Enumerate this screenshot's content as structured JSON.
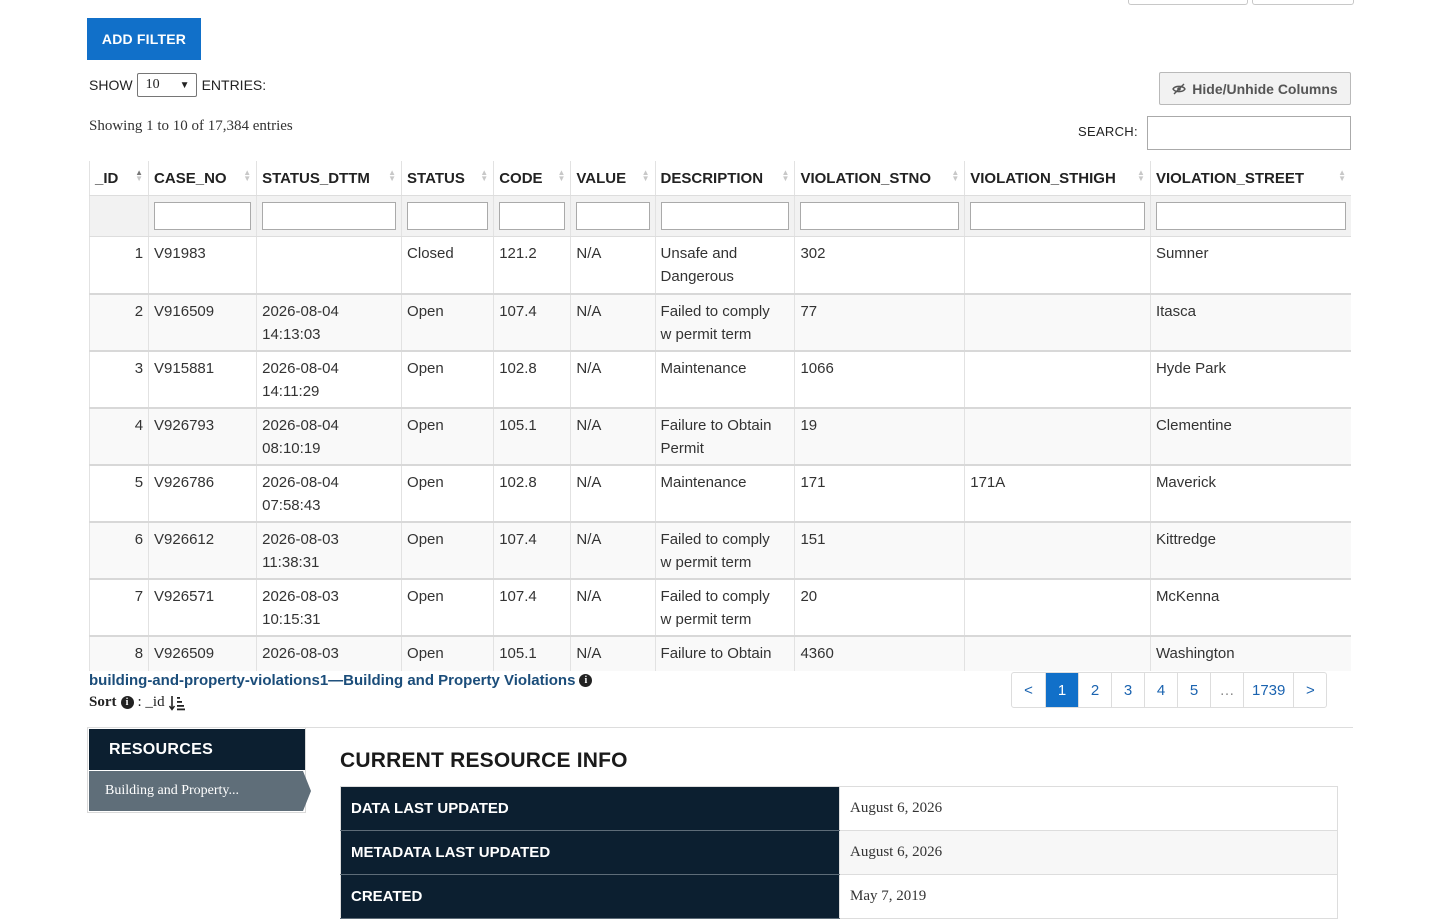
{
  "toolbar": {
    "add_filter_label": "ADD FILTER",
    "show_label": "SHOW",
    "show_value": "10",
    "entries_label": "ENTRIES:",
    "hide_columns_label": "Hide/Unhide Columns",
    "showing_text": "Showing 1 to 10 of 17,384 entries",
    "search_label": "SEARCH:"
  },
  "table": {
    "columns": [
      "_ID",
      "CASE_NO",
      "STATUS_DTTM",
      "STATUS",
      "CODE",
      "VALUE",
      "DESCRIPTION",
      "VIOLATION_STNO",
      "VIOLATION_STHIGH",
      "VIOLATION_STREET"
    ],
    "rows": [
      {
        "id": "1",
        "case_no": "V91983",
        "status_dttm_date": "",
        "status_dttm_time": "",
        "status": "Closed",
        "code": "121.2",
        "value": "N/A",
        "desc1": "Unsafe and",
        "desc2": "Dangerous",
        "stno": "302",
        "sthigh": "",
        "street": "Sumner"
      },
      {
        "id": "2",
        "case_no": "V916509",
        "status_dttm_date": "2026-08-04",
        "status_dttm_time": "14:13:03",
        "status": "Open",
        "code": "107.4",
        "value": "N/A",
        "desc1": "Failed to comply",
        "desc2": "w permit term",
        "stno": "77",
        "sthigh": "",
        "street": "Itasca"
      },
      {
        "id": "3",
        "case_no": "V915881",
        "status_dttm_date": "2026-08-04",
        "status_dttm_time": "14:11:29",
        "status": "Open",
        "code": "102.8",
        "value": "N/A",
        "desc1": "Maintenance",
        "desc2": "",
        "stno": "1066",
        "sthigh": "",
        "street": "Hyde Park"
      },
      {
        "id": "4",
        "case_no": "V926793",
        "status_dttm_date": "2026-08-04",
        "status_dttm_time": "08:10:19",
        "status": "Open",
        "code": "105.1",
        "value": "N/A",
        "desc1": "Failure to Obtain",
        "desc2": "Permit",
        "stno": "19",
        "sthigh": "",
        "street": "Clementine"
      },
      {
        "id": "5",
        "case_no": "V926786",
        "status_dttm_date": "2026-08-04",
        "status_dttm_time": "07:58:43",
        "status": "Open",
        "code": "102.8",
        "value": "N/A",
        "desc1": "Maintenance",
        "desc2": "",
        "stno": "171",
        "sthigh": "171A",
        "street": "Maverick"
      },
      {
        "id": "6",
        "case_no": "V926612",
        "status_dttm_date": "2026-08-03",
        "status_dttm_time": "11:38:31",
        "status": "Open",
        "code": "107.4",
        "value": "N/A",
        "desc1": "Failed to comply",
        "desc2": "w permit term",
        "stno": "151",
        "sthigh": "",
        "street": "Kittredge"
      },
      {
        "id": "7",
        "case_no": "V926571",
        "status_dttm_date": "2026-08-03",
        "status_dttm_time": "10:15:31",
        "status": "Open",
        "code": "107.4",
        "value": "N/A",
        "desc1": "Failed to comply",
        "desc2": "w permit term",
        "stno": "20",
        "sthigh": "",
        "street": "McKenna"
      },
      {
        "id": "8",
        "case_no": "V926509",
        "status_dttm_date": "2026-08-03",
        "status_dttm_time": "",
        "status": "Open",
        "code": "105.1",
        "value": "N/A",
        "desc1": "Failure to Obtain",
        "desc2": "",
        "stno": "4360",
        "sthigh": "",
        "street": "Washington"
      }
    ]
  },
  "footer": {
    "dataset_link": "building-and-property-violations1—Building and Property Violations",
    "sort_label": "Sort",
    "sort_value": ": _id"
  },
  "pager": {
    "prev": "<",
    "pages": [
      "1",
      "2",
      "3",
      "4",
      "5"
    ],
    "ellipsis": "…",
    "last": "1739",
    "next": ">"
  },
  "resources": {
    "header": "RESOURCES",
    "item": "Building and Property..."
  },
  "resource_info": {
    "title": "CURRENT RESOURCE INFO",
    "rows": [
      {
        "key": "DATA LAST UPDATED",
        "value": "August 6, 2026"
      },
      {
        "key": "METADATA LAST UPDATED",
        "value": "August 6, 2026"
      },
      {
        "key": "CREATED",
        "value": "May 7, 2019"
      }
    ]
  },
  "colors": {
    "primary": "#1170c9",
    "navy": "#0c1f30",
    "resource_item": "#5f6e79"
  }
}
